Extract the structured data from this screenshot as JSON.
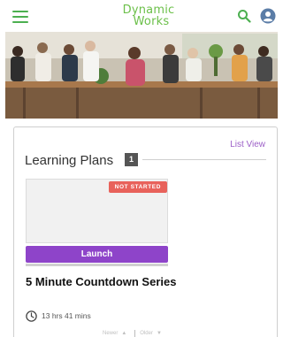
{
  "header": {
    "logo_line1": "Dynamic",
    "logo_line2": "Works",
    "menu_icon": "hamburger-menu-icon",
    "search_icon": "search-icon",
    "account_icon": "account-icon",
    "accent_color": "#4caf50"
  },
  "hero": {
    "image": "office-team-photo"
  },
  "learning_plans": {
    "title": "Learning Plans",
    "count": "1",
    "list_view_label": "List View",
    "plan": {
      "status": "NOT STARTED",
      "launch_label": "Launch",
      "progress": 1.0,
      "title": "5 Minute Countdown Series",
      "duration": "13 hrs 41 mins"
    },
    "sort": {
      "left_label": "Newer",
      "right_label": "Older"
    }
  },
  "colors": {
    "launch_button": "#8e44c9",
    "status_badge": "#e8625b",
    "list_view_link": "#9c5fc7"
  }
}
